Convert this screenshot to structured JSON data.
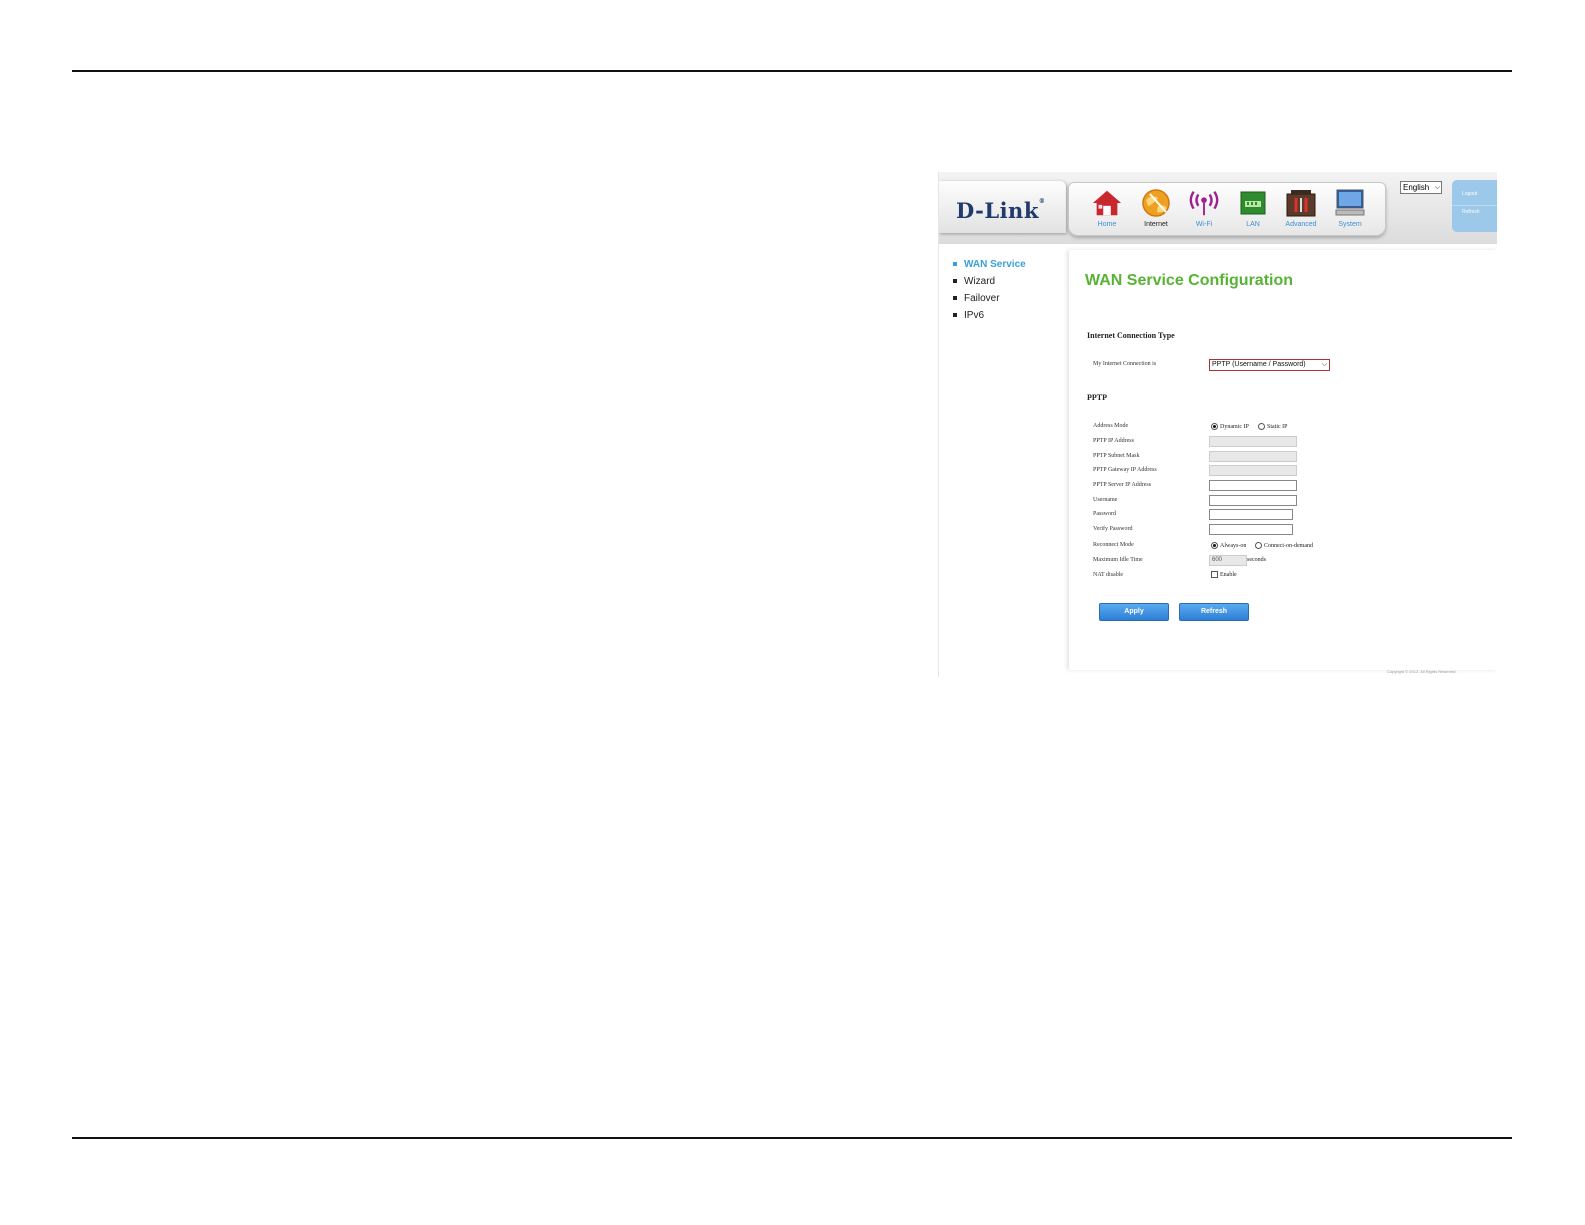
{
  "brand": {
    "logo_text": "D-Link"
  },
  "nav": [
    {
      "label": "Home",
      "icon": "home-icon"
    },
    {
      "label": "Internet",
      "icon": "globe-icon"
    },
    {
      "label": "Wi-Fi",
      "icon": "wifi-icon"
    },
    {
      "label": "LAN",
      "icon": "lan-icon"
    },
    {
      "label": "Advanced",
      "icon": "toolbox-icon"
    },
    {
      "label": "System",
      "icon": "computer-icon"
    }
  ],
  "language": {
    "selected": "English"
  },
  "side_tab": {
    "logout": "Logout",
    "refresh": "Refresh"
  },
  "sidebar": {
    "items": [
      {
        "label": "WAN Service",
        "active": true
      },
      {
        "label": "Wizard",
        "active": false
      },
      {
        "label": "Failover",
        "active": false
      },
      {
        "label": "IPv6",
        "active": false
      }
    ]
  },
  "page": {
    "title": "WAN Service Configuration",
    "connection_section": "Internet Connection Type",
    "connection_label": "My Internet Connection is",
    "connection_value": "PPTP (Username / Password)",
    "pptp_section": "PPTP",
    "fields": {
      "address_mode": "Address Mode",
      "dynamic_ip": "Dynamic IP",
      "static_ip": "Static IP",
      "pptp_ip": "PPTP IP Address",
      "pptp_mask": "PPTP Subnet Mask",
      "pptp_gateway": "PPTP Gateway IP Address",
      "pptp_server": "PPTP Server IP Address",
      "username": "Username",
      "password": "Password",
      "verify_password": "Verify Password",
      "reconnect_mode": "Reconnect Mode",
      "always_on": "Always-on",
      "connect_on_demand": "Connect-on-demand",
      "max_idle": "Maximum Idle Time",
      "max_idle_value": "600",
      "seconds": "seconds",
      "nat_disable": "NAT disable",
      "enable": "Enable"
    },
    "apply": "Apply",
    "refresh": "Refresh",
    "copyright": "Copyright © 2012. All Rights Reserved."
  },
  "colors": {
    "accent_green": "#58b335",
    "link_blue": "#3aa0dc",
    "button_blue": "#2d7fd4"
  }
}
